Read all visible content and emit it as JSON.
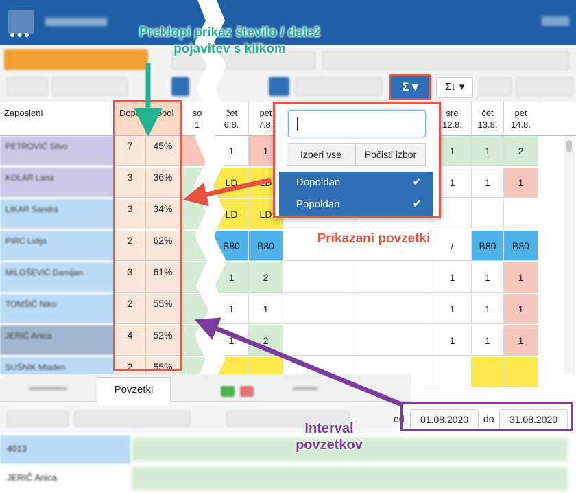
{
  "summary_table": {
    "header": {
      "employee_col": "Zaposleni",
      "sum_col_1": "Dopo",
      "sum_col_2": "popol",
      "days": [
        {
          "wd": "so",
          "d": "1"
        },
        {
          "wd": "čet",
          "d": "6.8."
        },
        {
          "wd": "pet",
          "d": "7.8."
        },
        {
          "wd": "sre",
          "d": "12.8."
        },
        {
          "wd": "čet",
          "d": "13.8."
        },
        {
          "wd": "pet",
          "d": "14.8."
        }
      ]
    },
    "rows": [
      {
        "name": "PETROVIĆ Silvo",
        "count": "7",
        "pct": "45%",
        "c1": "1",
        "c2": "1",
        "c3": "1",
        "c4": "1",
        "c5": "2"
      },
      {
        "name": "KOLAR Lana",
        "count": "3",
        "pct": "36%",
        "c1": "LD",
        "c2": "LD",
        "c3": "1",
        "c4": "1",
        "c5": "1"
      },
      {
        "name": "LIKAR Sandra",
        "count": "3",
        "pct": "34%",
        "c1": "LD",
        "c2": "LD",
        "c3": "",
        "c4": "",
        "c5": ""
      },
      {
        "name": "PIRC Lidija",
        "count": "2",
        "pct": "62%",
        "c1": "B80",
        "c2": "B80",
        "c3": "/",
        "c4": "B80",
        "c5": "B80"
      },
      {
        "name": "MILOŠEVIĆ Damijan",
        "count": "3",
        "pct": "61%",
        "c1": "1",
        "c2": "2",
        "c3": "1",
        "c4": "1",
        "c5": "1"
      },
      {
        "name": "TOMŠIČ Niko",
        "count": "2",
        "pct": "55%",
        "c1": "1",
        "c2": "1",
        "c3": "1",
        "c4": "1",
        "c5": "1"
      },
      {
        "name": "JERIČ Anica",
        "count": "4",
        "pct": "52%",
        "c1": "1",
        "c2": "2",
        "c3": "1",
        "c4": "1",
        "c5": "1"
      },
      {
        "name": "SUŠNIK Mladen",
        "count": "2",
        "pct": "55%",
        "c1": "",
        "c2": "",
        "c3": "",
        "c4": "",
        "c5": ""
      }
    ]
  },
  "summary_dropdown": {
    "search_value": "",
    "select_all": "Izberi vse",
    "clear_selection": "Počisti izbor",
    "options": [
      "Dopoldan",
      "Popoldan"
    ],
    "check_glyph": "✔"
  },
  "toolbar": {
    "summary_button_label": "Σ ▾",
    "sort_button_label": "Σ↓ ▾"
  },
  "bottom_panel": {
    "tab_active": "Povzetki",
    "from_label": "od",
    "from_value": "01.08.2020",
    "to_label": "do",
    "to_value": "31.08.2020",
    "rows": [
      {
        "name": "4013"
      },
      {
        "name": "JERIČ Anica"
      }
    ]
  },
  "annotations": {
    "toggle_line1": "Preklopi prikaz število / delež",
    "toggle_line2": "pojavitev s klikom",
    "shown_summaries": "Prikazani povzetki",
    "interval_line1": "Interval",
    "interval_line2": "povzetkov"
  },
  "colors": {
    "primary": "#2f6fb5",
    "annotation_red": "#e2584d",
    "annotation_green": "#22b48f",
    "annotation_purple": "#7b3c9e"
  }
}
